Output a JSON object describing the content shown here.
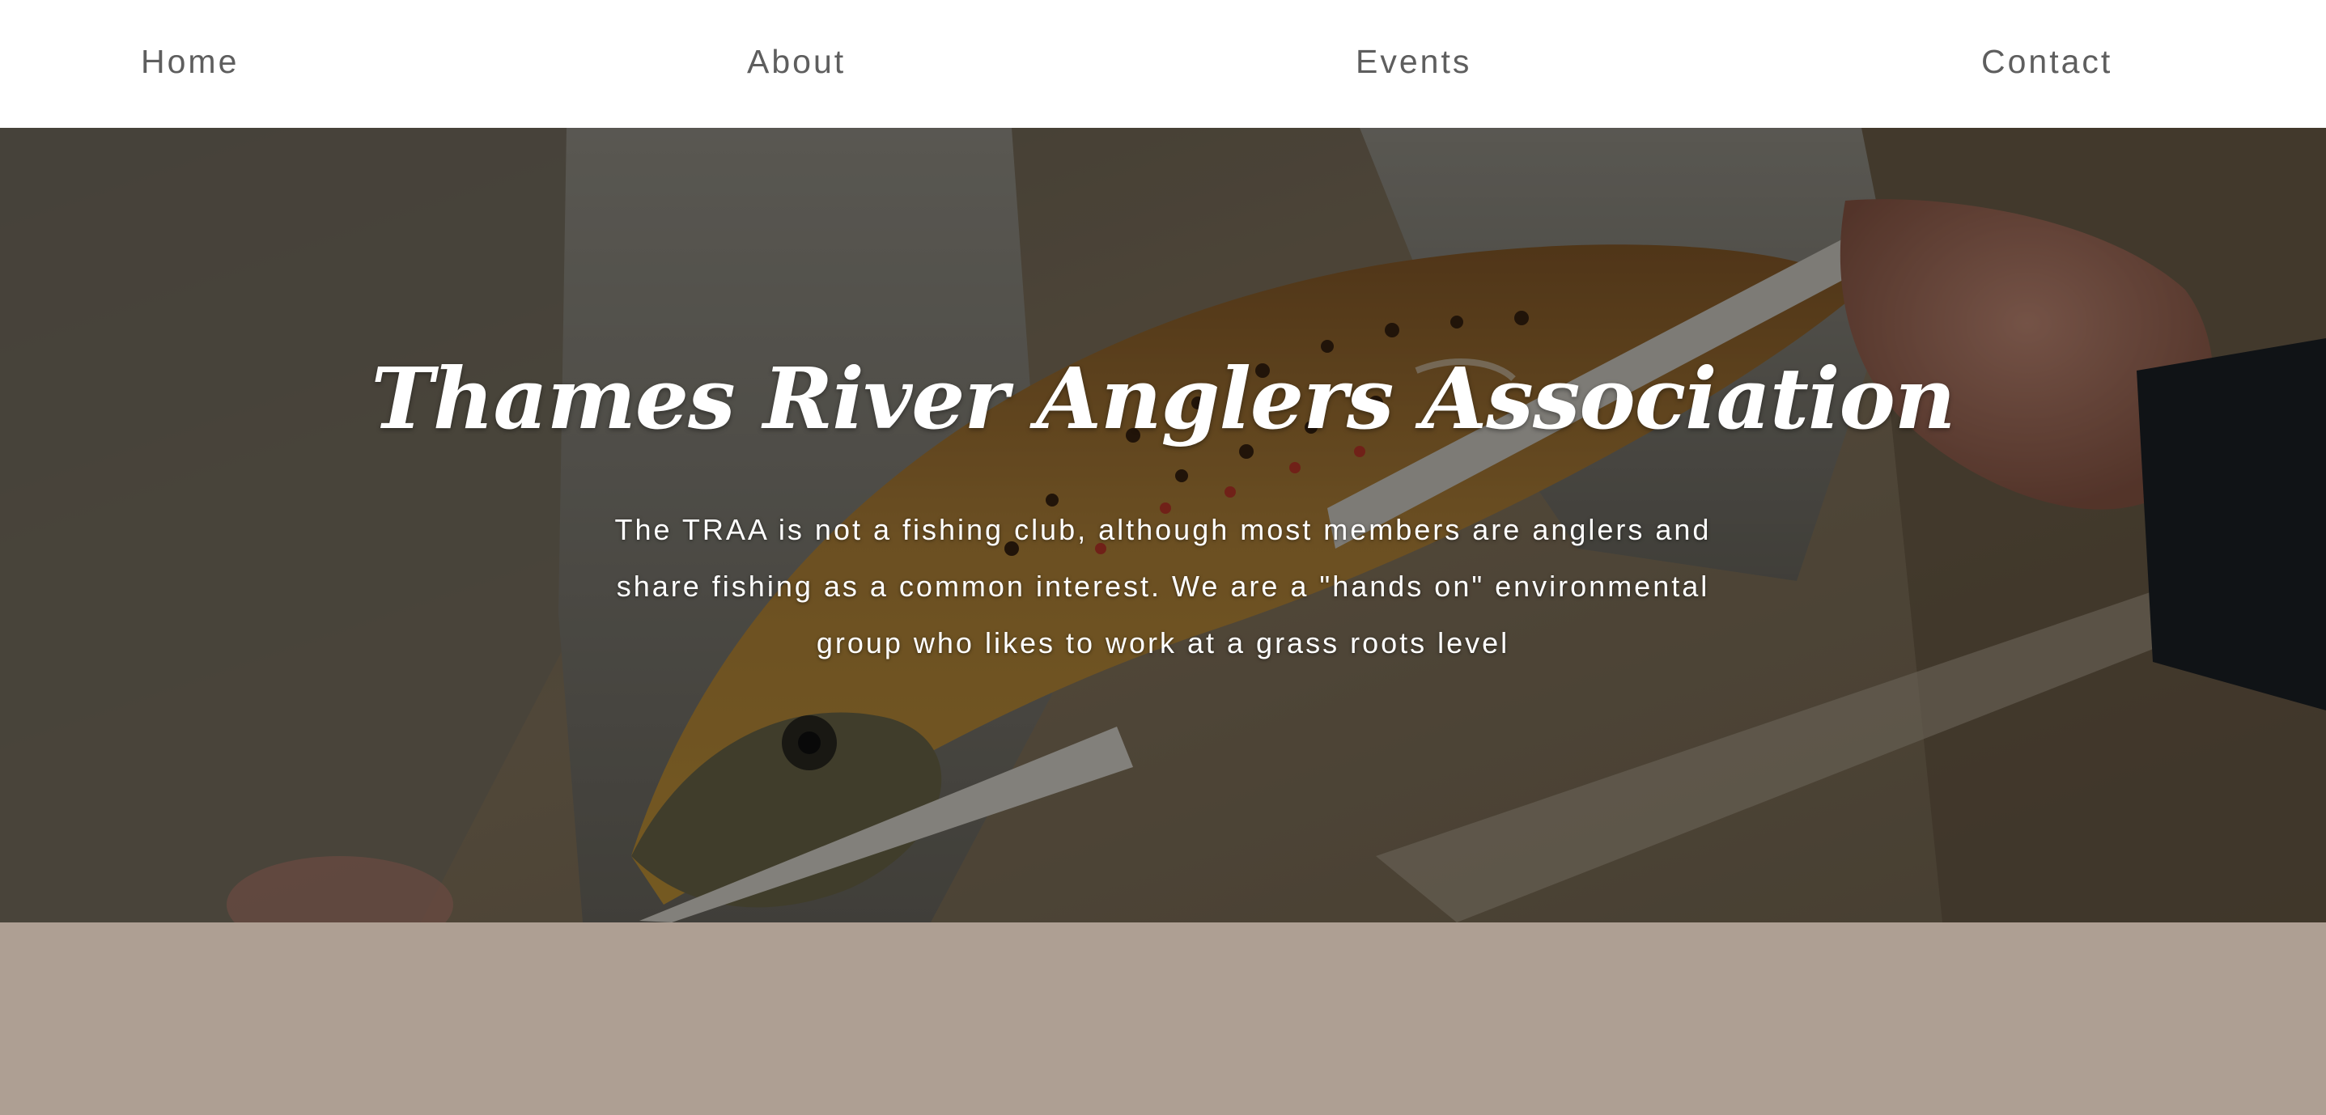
{
  "nav": {
    "items": [
      {
        "label": "Home"
      },
      {
        "label": "About"
      },
      {
        "label": "Events"
      },
      {
        "label": "Contact"
      }
    ]
  },
  "hero": {
    "title": "Thames River Anglers Association",
    "description": "The TRAA is not a fishing club, although most members are anglers and share fishing as a common interest. We are a \"hands on\" environmental group who likes to work at a grass roots level"
  },
  "colors": {
    "nav_background": "#ffffff",
    "nav_text": "#5e5e5e",
    "hero_text": "#ffffff",
    "footer_band": "#ae9f93"
  }
}
